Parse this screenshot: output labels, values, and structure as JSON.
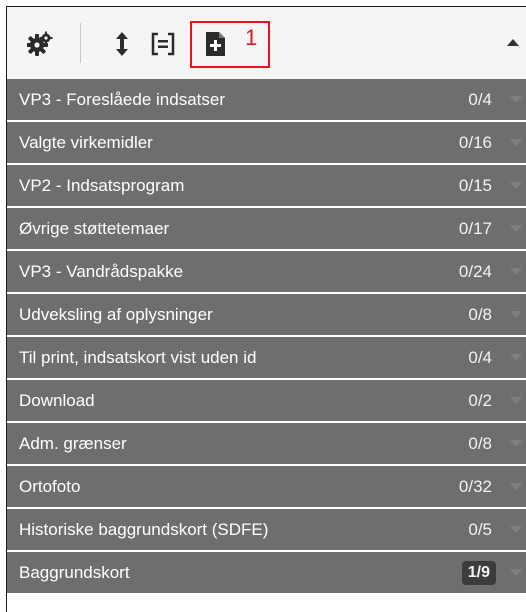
{
  "toolbar": {
    "icons": [
      "gear-icon",
      "expand-vertical-icon",
      "collapse-all-icon",
      "add-file-icon"
    ],
    "highlight_number": "1",
    "highlight_color": "#e8141b"
  },
  "layers": [
    {
      "label": "VP3 - Foreslåede indsatser",
      "count": "0/4"
    },
    {
      "label": "Valgte virkemidler",
      "count": "0/16"
    },
    {
      "label": "VP2 - Indsatsprogram",
      "count": "0/15"
    },
    {
      "label": "Øvrige støttetemaer",
      "count": "0/17"
    },
    {
      "label": "VP3 - Vandrådspakke",
      "count": "0/24"
    },
    {
      "label": "Udveksling af oplysninger",
      "count": "0/8"
    },
    {
      "label": "Til print, indsatskort vist uden id",
      "count": "0/4"
    },
    {
      "label": "Download",
      "count": "0/2"
    },
    {
      "label": "Adm. grænser",
      "count": "0/8"
    },
    {
      "label": "Ortofoto",
      "count": "0/32"
    },
    {
      "label": "Historiske baggrundskort (SDFE)",
      "count": "0/5"
    },
    {
      "label": "Baggrundskort",
      "count": "1/9"
    }
  ],
  "colors": {
    "row_background": "#6e6e6e",
    "toolbar_background": "#f5f5f5",
    "active_badge": "#3c3c3c"
  }
}
